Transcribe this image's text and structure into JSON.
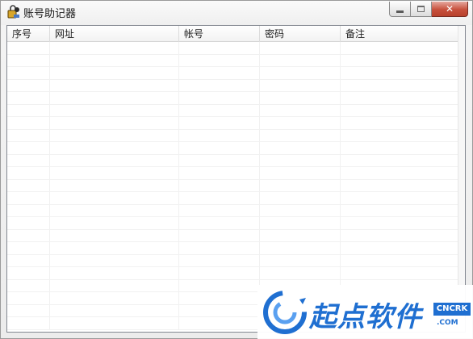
{
  "window": {
    "title": "账号助记器"
  },
  "listview": {
    "columns": [
      {
        "label": "序号"
      },
      {
        "label": "网址"
      },
      {
        "label": "帐号"
      },
      {
        "label": "密码"
      },
      {
        "label": "备注"
      }
    ],
    "rows": []
  },
  "watermark": {
    "brand": "起点软件",
    "badge": "CNCRK",
    "domain": ".COM"
  },
  "colors": {
    "close_button": "#c7503c",
    "watermark_blue": "#1f6fd1"
  }
}
